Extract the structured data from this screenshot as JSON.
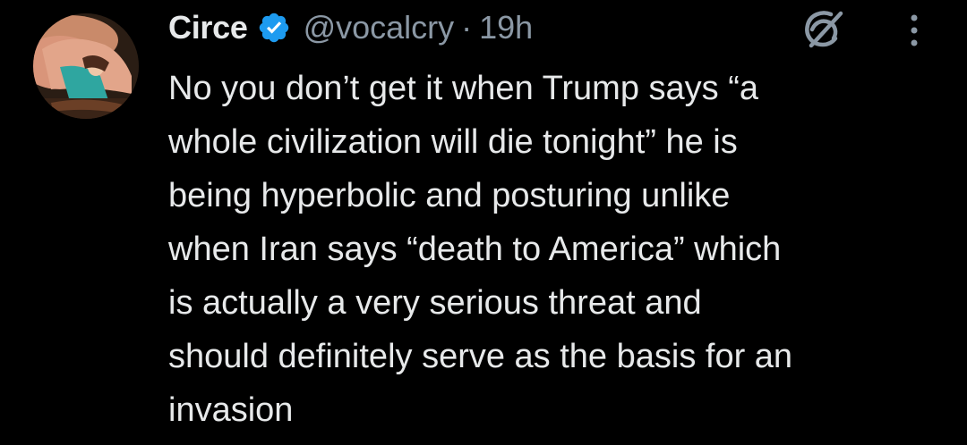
{
  "author": {
    "display_name": "Circe",
    "handle": "@vocalcry",
    "separator": "·",
    "timestamp": "19h",
    "verified": true
  },
  "icons": {
    "verified": "verified-badge-icon",
    "grok": "grok-icon",
    "more": "more-options-icon"
  },
  "colors": {
    "background": "#000000",
    "text": "#e7e9ea",
    "secondary_text": "#8b98a5",
    "verified_badge": "#1d9bf0"
  },
  "tweet": {
    "lines": [
      "No you don’t get it when Trump says “a",
      "whole civilization will die tonight” he is",
      "being hyperbolic and posturing unlike",
      "when Iran says “death to America” which",
      "is actually a very serious threat and",
      "should definitely serve as the basis for an",
      "invasion"
    ]
  }
}
